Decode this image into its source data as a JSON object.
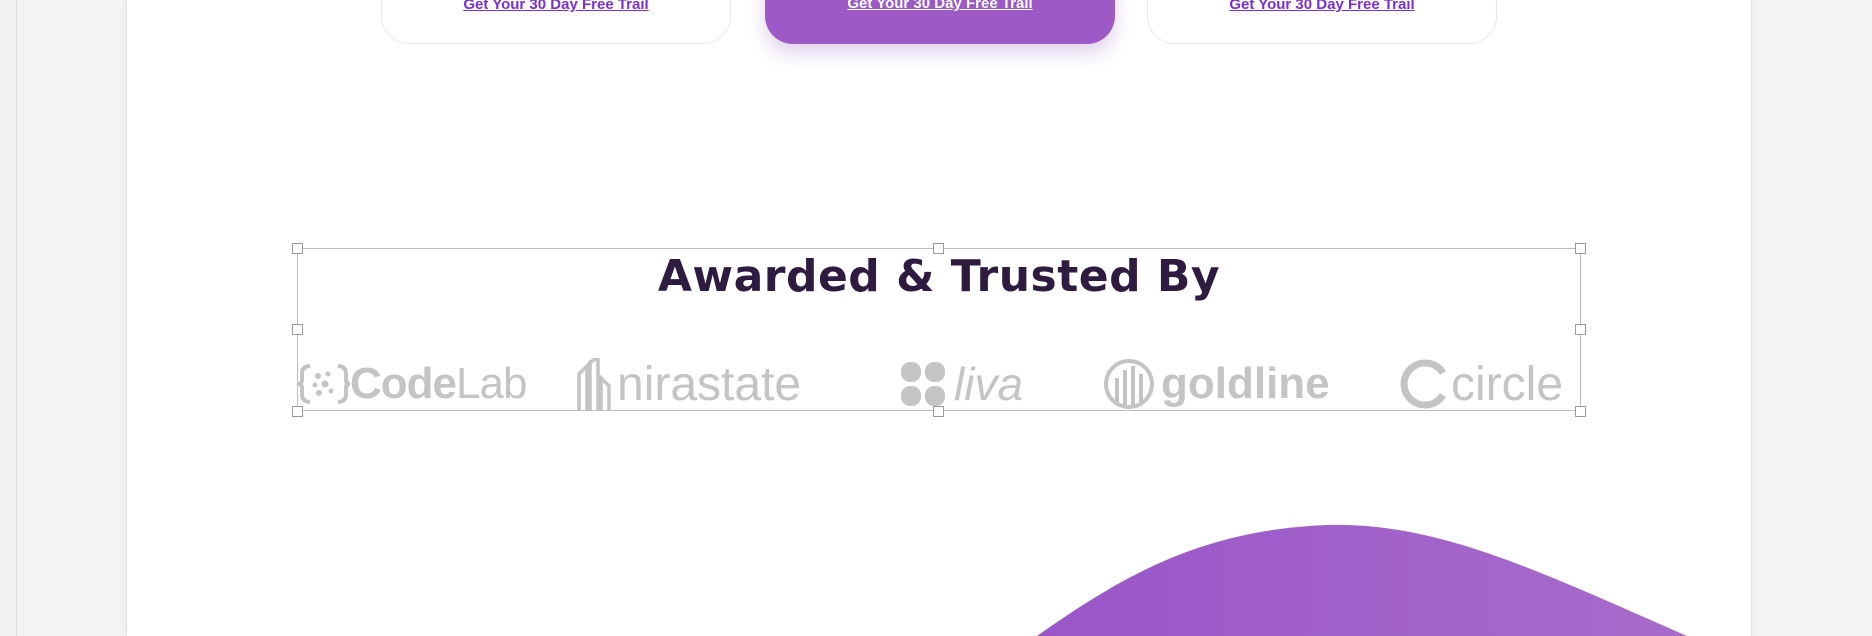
{
  "pricing_cards": [
    {
      "cta_label": "Get Your 30 Day Free Trail",
      "featured": false
    },
    {
      "cta_label": "Get Your 30 Day Free Trail",
      "featured": true
    },
    {
      "cta_label": "Get Your 30 Day Free Trail",
      "featured": false
    }
  ],
  "awards_section": {
    "heading": "Awarded & Trusted By",
    "logos": [
      {
        "name": "CodeLab",
        "part1": "Code",
        "part2": "Lab",
        "icon": "codelab-brackets-icon"
      },
      {
        "name": "nirastate",
        "text": "nirastate",
        "icon": "nirastate-building-icon"
      },
      {
        "name": "liva",
        "text": "liva",
        "icon": "liva-clover-icon"
      },
      {
        "name": "goldline",
        "text": "goldline",
        "icon": "goldline-circle-icon"
      },
      {
        "name": "circle",
        "text": "circle",
        "icon": "circle-ring-icon"
      }
    ]
  },
  "colors": {
    "accent_purple": "#9d59c6",
    "link_purple": "#7b2fd0",
    "heading": "#2d1b40",
    "logo_gray": "#c4c4c4"
  }
}
